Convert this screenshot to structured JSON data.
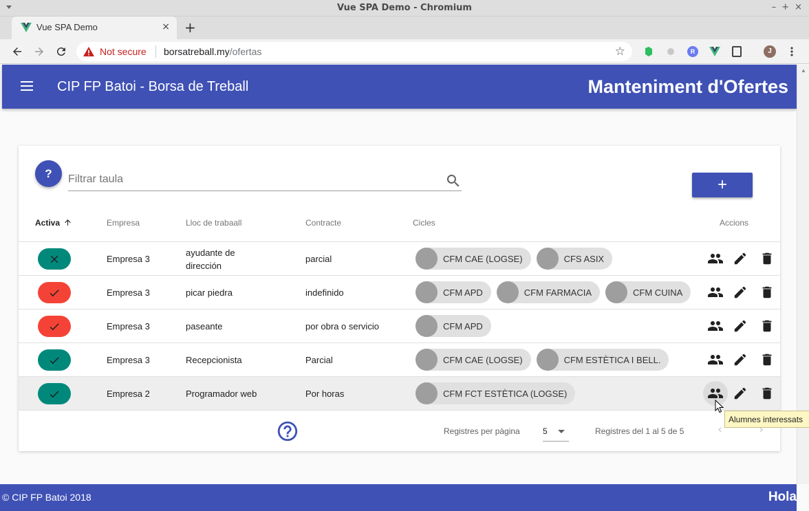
{
  "window": {
    "title": "Vue SPA Demo - Chromium"
  },
  "browser": {
    "tab_title": "Vue SPA Demo",
    "security_label": "Not secure",
    "url_host": "borsatreball.my",
    "url_path": "/ofertas",
    "profile_initial": "J"
  },
  "header": {
    "app_title": "CIP FP Batoi - Borsa de Treball",
    "page_title": "Manteniment d'Ofertes"
  },
  "toolbar": {
    "help_label": "?",
    "search_placeholder": "Filtrar taula",
    "add_label": "+"
  },
  "table": {
    "headers": {
      "activa": "Activa",
      "empresa": "Empresa",
      "lloc": "Lloc de trabaall",
      "contracte": "Contracte",
      "cicles": "Cicles",
      "accions": "Accions"
    },
    "rows": [
      {
        "active": false,
        "empresa": "Empresa 3",
        "lloc": "ayudante de dirección",
        "contracte": "parcial",
        "cicles": [
          "CFM CAE (LOGSE)",
          "CFS ASIX"
        ]
      },
      {
        "active": true,
        "empresa": "Empresa 3",
        "lloc": "picar piedra",
        "contracte": "indefinido",
        "cicles": [
          "CFM APD",
          "CFM FARMACIA",
          "CFM CUINA"
        ]
      },
      {
        "active": true,
        "empresa": "Empresa 3",
        "lloc": "paseante",
        "contracte": "por obra o servicio",
        "cicles": [
          "CFM APD"
        ]
      },
      {
        "active": true,
        "empresa": "Empresa 3",
        "lloc": "Recepcionista",
        "contracte": "Parcial",
        "cicles": [
          "CFM CAE (LOGSE)",
          "CFM ESTÈTICA I BELL."
        ]
      },
      {
        "active": true,
        "empresa": "Empresa 2",
        "lloc": "Programador web",
        "contracte": "Por horas",
        "cicles": [
          "CFM FCT ESTÈTICA (LOGSE)"
        ]
      }
    ]
  },
  "pagination": {
    "rows_per_page_label": "Registres per pàgina",
    "rows_per_page_value": "5",
    "range_text": "Registres del 1 al 5 de 5"
  },
  "tooltip": {
    "text": "Alumnes interessats"
  },
  "footer": {
    "copyright": "© CIP FP Batoi 2018",
    "greeting": "Hola"
  },
  "colors": {
    "primary": "#3f51b5",
    "active_green": "#00897b",
    "inactive_red": "#f44336",
    "warning_red": "#c5221f"
  }
}
